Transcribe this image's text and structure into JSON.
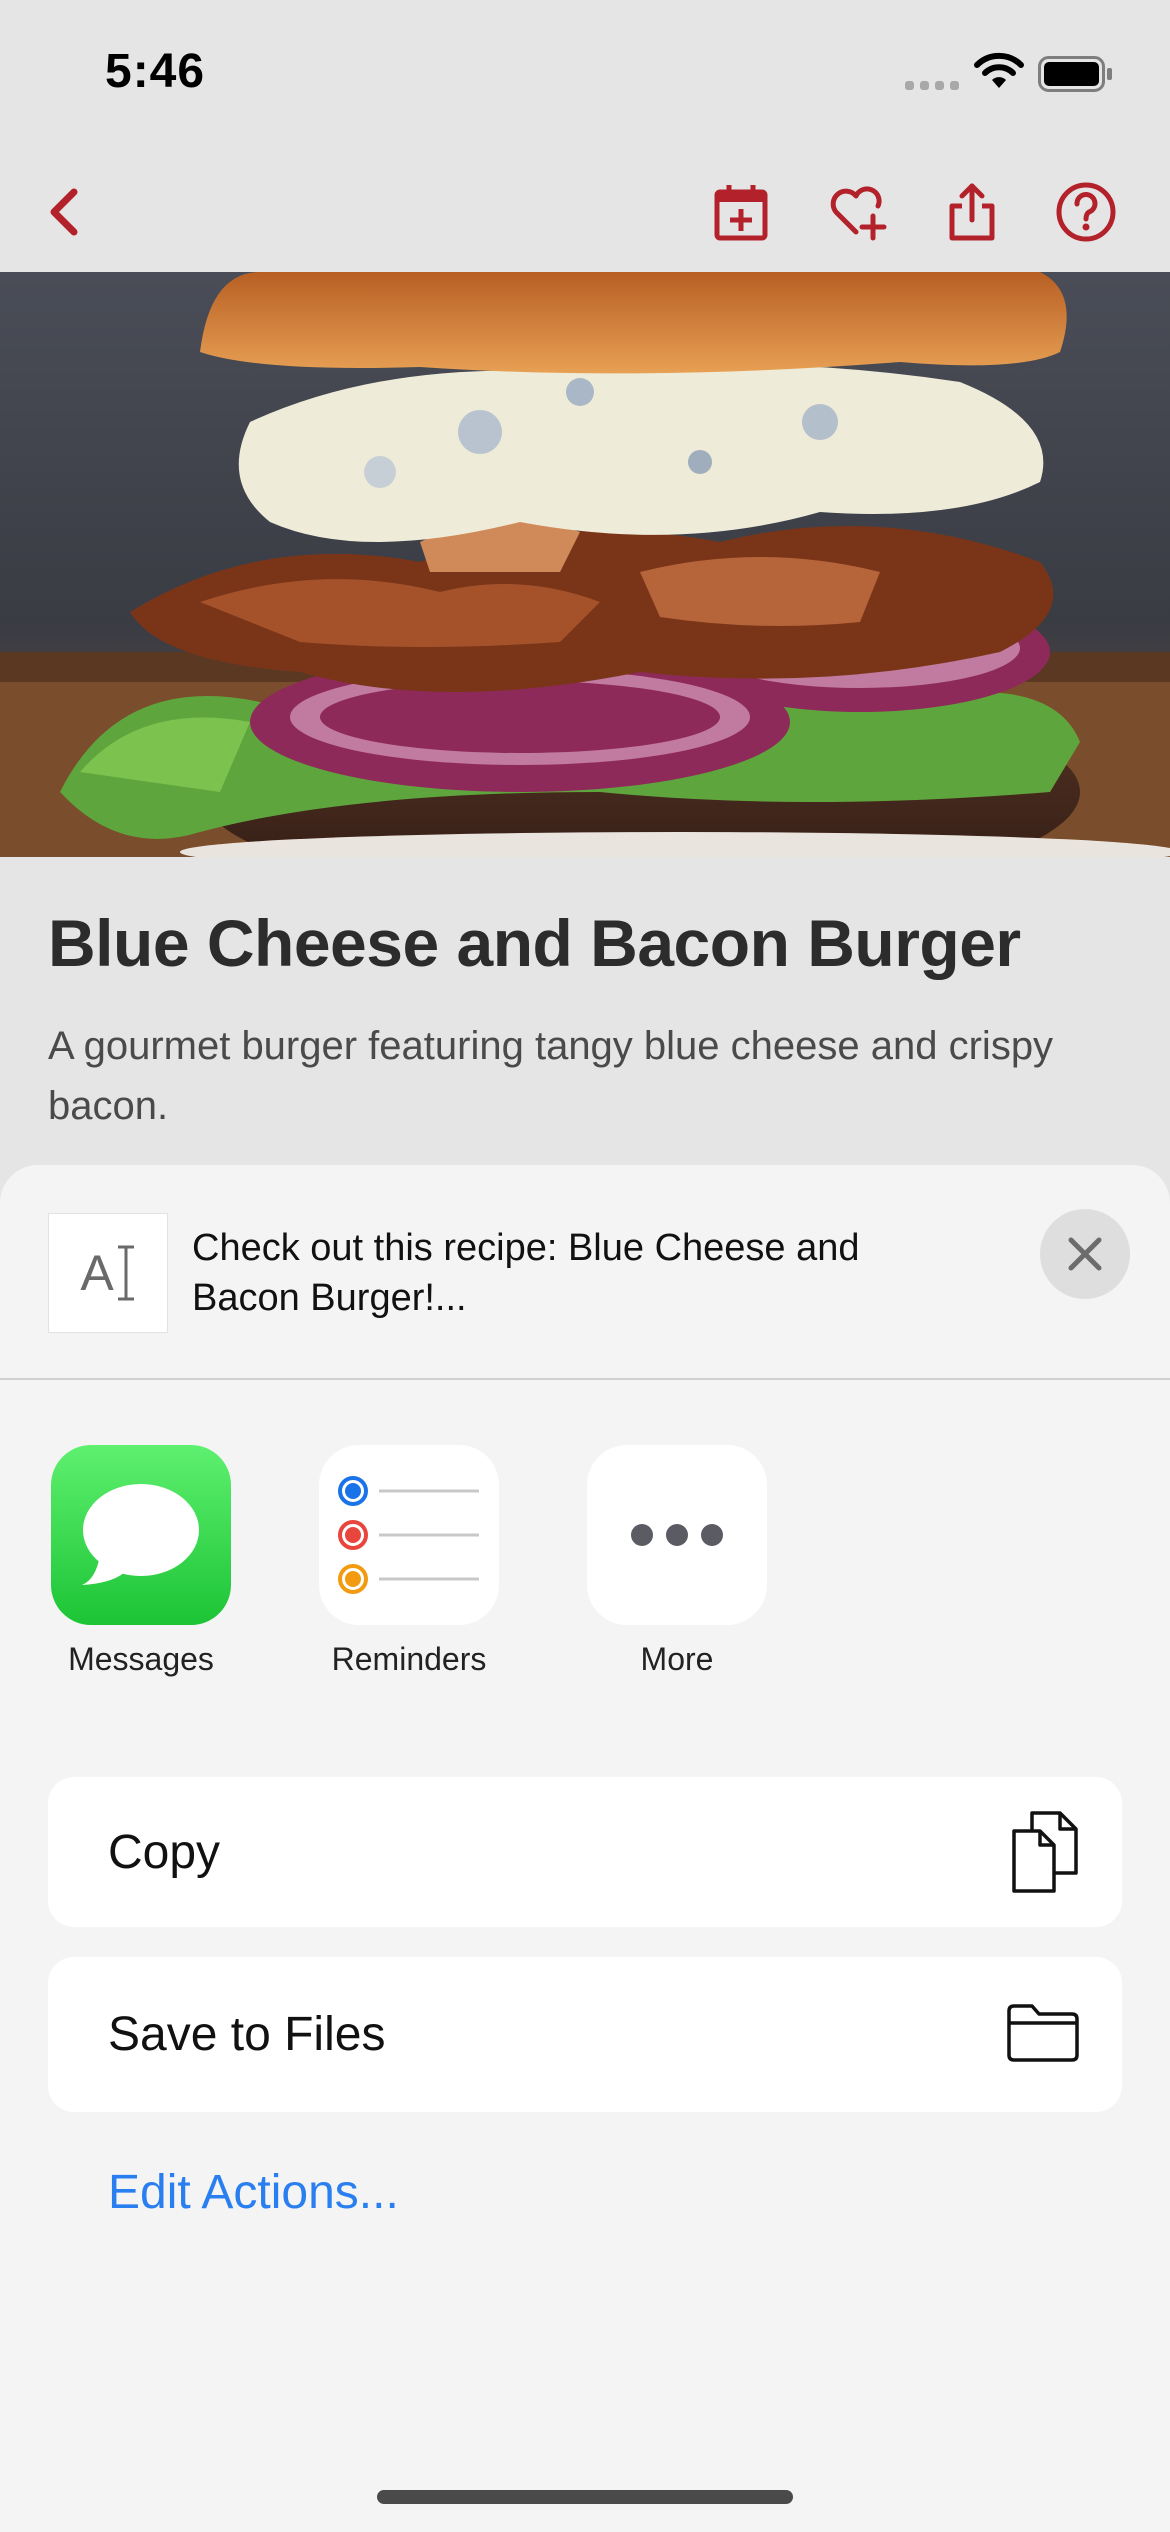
{
  "status_bar": {
    "time": "5:46"
  },
  "nav": {
    "icons": [
      "back-chevron-icon",
      "calendar-add-icon",
      "heart-add-icon",
      "share-icon",
      "help-icon"
    ],
    "accent_color": "#b3222b"
  },
  "recipe": {
    "title": "Blue Cheese and Bacon Burger",
    "description": "A gourmet burger featuring tangy blue cheese and crispy bacon."
  },
  "share_sheet": {
    "preview_thumb_glyph": "A",
    "preview_text": "Check out this recipe: Blue Cheese and Bacon Burger!...",
    "apps": [
      {
        "label": "Messages",
        "icon": "messages-icon"
      },
      {
        "label": "Reminders",
        "icon": "reminders-icon"
      },
      {
        "label": "More",
        "icon": "more-icon"
      }
    ],
    "actions": [
      {
        "label": "Copy",
        "icon": "copy-icon"
      },
      {
        "label": "Save to Files",
        "icon": "folder-icon"
      }
    ],
    "edit_actions": "Edit Actions...",
    "link_color": "#2a7ff0"
  }
}
